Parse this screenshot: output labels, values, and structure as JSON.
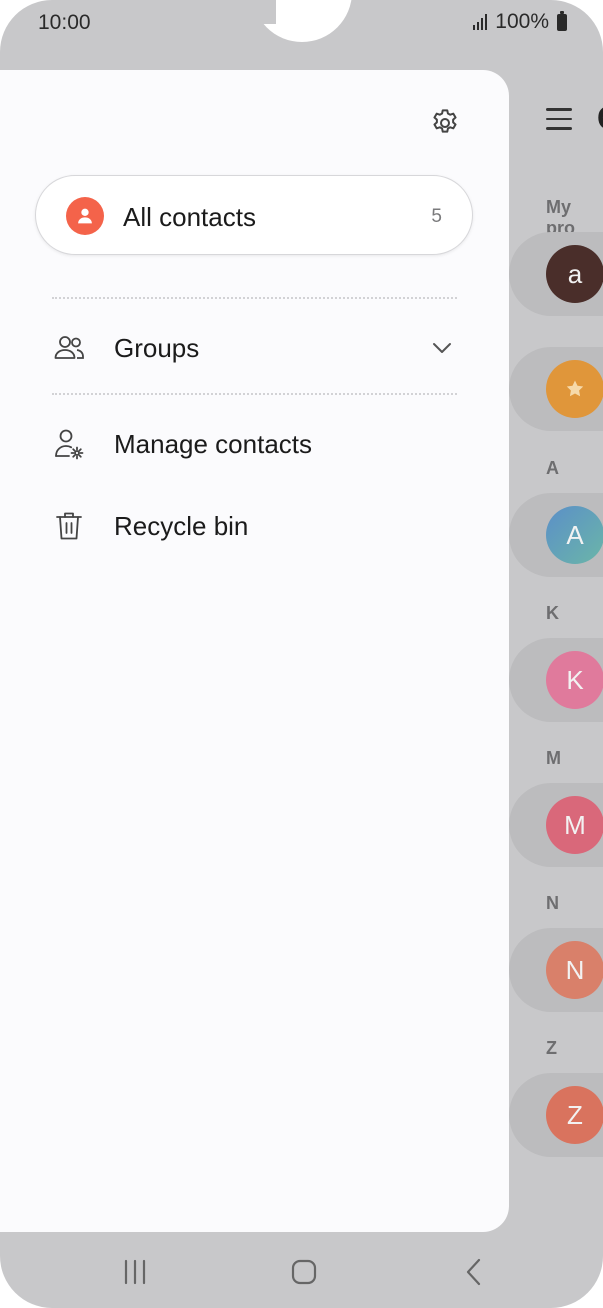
{
  "status_bar": {
    "time": "10:00",
    "battery_text": "100%"
  },
  "drawer": {
    "settings_icon": "gear-icon",
    "all_contacts": {
      "label": "All contacts",
      "count": "5",
      "icon": "person-icon",
      "icon_color": "#f4634a"
    },
    "menu": [
      {
        "label": "Groups",
        "icon": "groups-icon",
        "expandable": true
      },
      {
        "label": "Manage contacts",
        "icon": "manage-contacts-icon"
      },
      {
        "label": "Recycle bin",
        "icon": "trash-icon"
      }
    ]
  },
  "background_list": {
    "section_my_profile": "My pro",
    "title_fragment": "C",
    "sections": [
      "A",
      "K",
      "M",
      "N",
      "Z"
    ],
    "avatars": [
      {
        "letter": "a",
        "color": "#4a2e2a"
      },
      {
        "letter": "",
        "icon": "star-icon",
        "color": "#e0963a"
      },
      {
        "letter": "A",
        "color": "#5b8fc8"
      },
      {
        "letter": "K",
        "color": "#e07a9c"
      },
      {
        "letter": "M",
        "color": "#d9687a"
      },
      {
        "letter": "N",
        "color": "#d9806a"
      },
      {
        "letter": "Z",
        "color": "#d9735e"
      }
    ]
  },
  "navbar": {
    "recents_icon": "recents-icon",
    "home_icon": "home-icon",
    "back_icon": "back-icon"
  }
}
